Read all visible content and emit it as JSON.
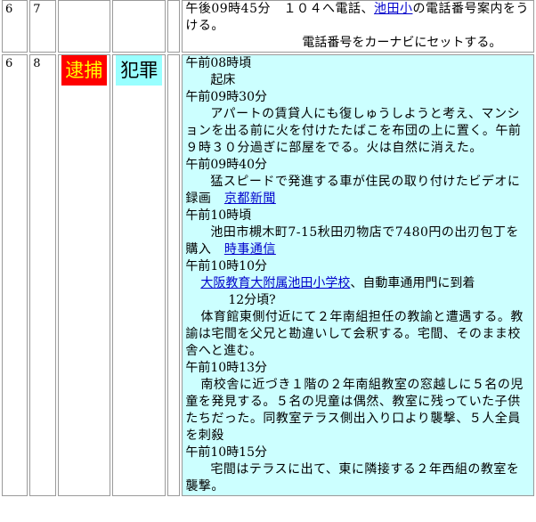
{
  "rows": [
    {
      "col1": "6",
      "col2": "7",
      "entry_text": "午後09時45分　１０４へ電話、",
      "entry_link": "池田小",
      "entry_text2": "の電話番号案内をうける。",
      "entry_line2": "電話番号をカーナビにセットする。"
    },
    {
      "col1": "6",
      "col2": "8",
      "tag_red": "逮捕",
      "tag_cyan": "犯罪",
      "t1": "午前08時頃",
      "t1_text": "起床",
      "t2": "午前09時30分",
      "t2_text": "アパートの賃貸人にも復しゅうしようと考え、マンションを出る前に火を付けたたばこを布団の上に置く。午前９時３０分過ぎに部屋をでる。火は自然に消えた。",
      "t3": "午前09時40分",
      "t3_text": "猛スピードで発進する車が住民の取り付けたビデオに録画",
      "t3_link": "京都新聞",
      "t4": "午前10時頃",
      "t4_text": "池田市槻木町7-15秋田刃物店で7480円の出刃包丁を購入",
      "t4_link": "時事通信",
      "t5": "午前10時10分",
      "t5_link": "大阪教育大附属池田小学校",
      "t5_text": "、自動車通用門に到着",
      "t5_sub": "12分頃?",
      "t5_text2": "体育館東側付近にて２年南組担任の教諭と遭遇する。教諭は宅間を父兄と勘違いして会釈する。宅間、そのまま校舎へと進む。",
      "t6": "午前10時13分",
      "t6_text": "南校舎に近づき１階の２年南組教室の窓越しに５名の児童を発見する。５名の児童は偶然、教室に残っていた子供たちだった。同教室テラス側出入り口より襲撃、５人全員を刺殺",
      "t7": "午前10時15分",
      "t7_text": "宅間はテラスに出て、東に隣接する２年西組の教室を襲撃。"
    }
  ]
}
